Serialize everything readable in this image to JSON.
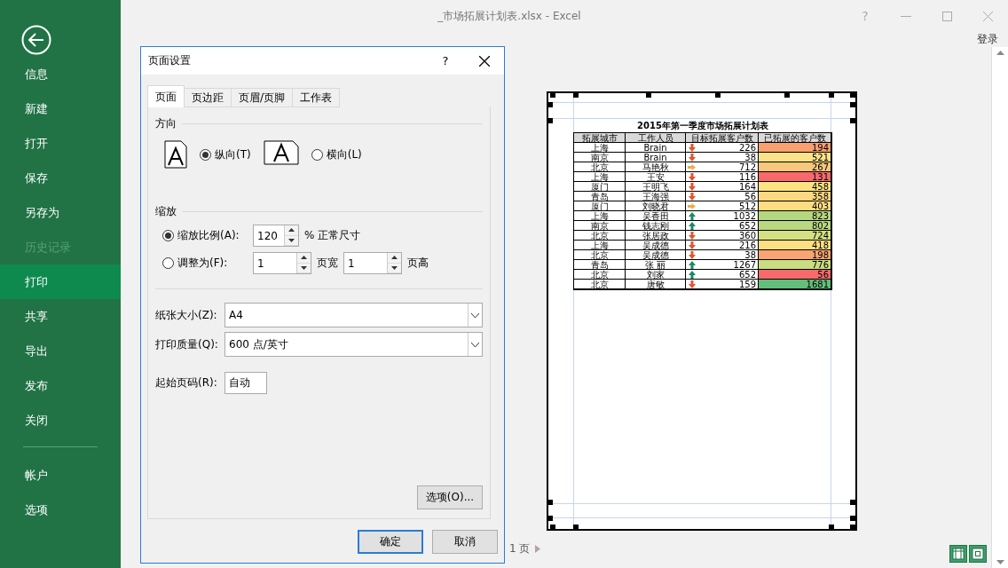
{
  "window": {
    "title": "_市场拓展计划表.xlsx - Excel",
    "help": "?",
    "sign_in": "登录"
  },
  "backstage": {
    "items": [
      {
        "label": "信息",
        "selected": false,
        "disabled": false
      },
      {
        "label": "新建",
        "selected": false,
        "disabled": false
      },
      {
        "label": "打开",
        "selected": false,
        "disabled": false
      },
      {
        "label": "保存",
        "selected": false,
        "disabled": false
      },
      {
        "label": "另存为",
        "selected": false,
        "disabled": false
      },
      {
        "label": "历史记录",
        "selected": false,
        "disabled": true
      },
      {
        "label": "打印",
        "selected": true,
        "disabled": false
      },
      {
        "label": "共享",
        "selected": false,
        "disabled": false
      },
      {
        "label": "导出",
        "selected": false,
        "disabled": false
      },
      {
        "label": "发布",
        "selected": false,
        "disabled": false
      },
      {
        "label": "关闭",
        "selected": false,
        "disabled": false
      }
    ],
    "footer_items": [
      {
        "label": "帐户",
        "selected": false,
        "disabled": false
      },
      {
        "label": "选项",
        "selected": false,
        "disabled": false
      }
    ]
  },
  "preview": {
    "page_nav": "1 页",
    "sheet": {
      "title": "2015年第一季度市场拓展计划表",
      "columns": [
        "拓展城市",
        "工作人员",
        "目标拓展客户数",
        "已拓展的客户数"
      ],
      "rows": [
        {
          "city": "上海",
          "staff": "Brain",
          "target": "226",
          "kind": "down",
          "done": "194",
          "color": "#f8a070"
        },
        {
          "city": "南京",
          "staff": "Brain",
          "target": "38",
          "kind": "down",
          "done": "521",
          "color": "#fce38a"
        },
        {
          "city": "北京",
          "staff": "马艳秋",
          "target": "712",
          "kind": "flat",
          "done": "267",
          "color": "#f9c77c"
        },
        {
          "city": "上海",
          "staff": "王安",
          "target": "116",
          "kind": "down",
          "done": "131",
          "color": "#f8696b"
        },
        {
          "city": "厦门",
          "staff": "王明飞",
          "target": "164",
          "kind": "down",
          "done": "458",
          "color": "#fde283"
        },
        {
          "city": "青岛",
          "staff": "王海强",
          "target": "56",
          "kind": "down",
          "done": "358",
          "color": "#fed880"
        },
        {
          "city": "厦门",
          "staff": "刘晓君",
          "target": "512",
          "kind": "flat",
          "done": "403",
          "color": "#fddc82"
        },
        {
          "city": "上海",
          "staff": "吴香田",
          "target": "1032",
          "kind": "up",
          "done": "823",
          "color": "#b5d77f"
        },
        {
          "city": "南京",
          "staff": "钱志刚",
          "target": "652",
          "kind": "up",
          "done": "802",
          "color": "#b9d880"
        },
        {
          "city": "北京",
          "staff": "张居政",
          "target": "360",
          "kind": "down",
          "done": "724",
          "color": "#d5e082"
        },
        {
          "city": "上海",
          "staff": "吴成德",
          "target": "216",
          "kind": "down",
          "done": "418",
          "color": "#fddf83"
        },
        {
          "city": "北京",
          "staff": "吴成德",
          "target": "38",
          "kind": "down",
          "done": "198",
          "color": "#f9a472"
        },
        {
          "city": "青岛",
          "staff": "张  丽",
          "target": "1267",
          "kind": "up",
          "done": "776",
          "color": "#c9dd81"
        },
        {
          "city": "北京",
          "staff": "刘家",
          "target": "652",
          "kind": "up",
          "done": "56",
          "color": "#f8696b"
        },
        {
          "city": "北京",
          "staff": "唐敏",
          "target": "159",
          "kind": "down",
          "done": "1681",
          "color": "#63be7b"
        }
      ]
    }
  },
  "dialog": {
    "title": "页面设置",
    "help": "?",
    "tabs": [
      {
        "label": "页面",
        "selected": true
      },
      {
        "label": "页边距",
        "selected": false
      },
      {
        "label": "页眉/页脚",
        "selected": false
      },
      {
        "label": "工作表",
        "selected": false
      }
    ],
    "orientation": {
      "heading": "方向",
      "options": [
        {
          "label": "纵向(T)",
          "selected": true,
          "kind": "portrait"
        },
        {
          "label": "横向(L)",
          "selected": false,
          "kind": "landscape"
        }
      ]
    },
    "scaling": {
      "heading": "缩放",
      "options": [
        {
          "kind": "percent",
          "label": "缩放比例(A):",
          "selected": true,
          "value": "120",
          "suffix": "% 正常尺寸"
        },
        {
          "kind": "fit",
          "label": "调整为(F):",
          "selected": false,
          "wide_value": "1",
          "wide_label": "页宽",
          "tall_value": "1",
          "tall_label": "页高"
        }
      ]
    },
    "paper_size": {
      "label": "纸张大小(Z):",
      "value": "A4"
    },
    "print_quality": {
      "label": "打印质量(Q):",
      "value": "600 点/英寸"
    },
    "first_page": {
      "label": "起始页码(R):",
      "value": "自动"
    },
    "options_button": "选项(O)...",
    "ok": "确定",
    "cancel": "取消"
  }
}
